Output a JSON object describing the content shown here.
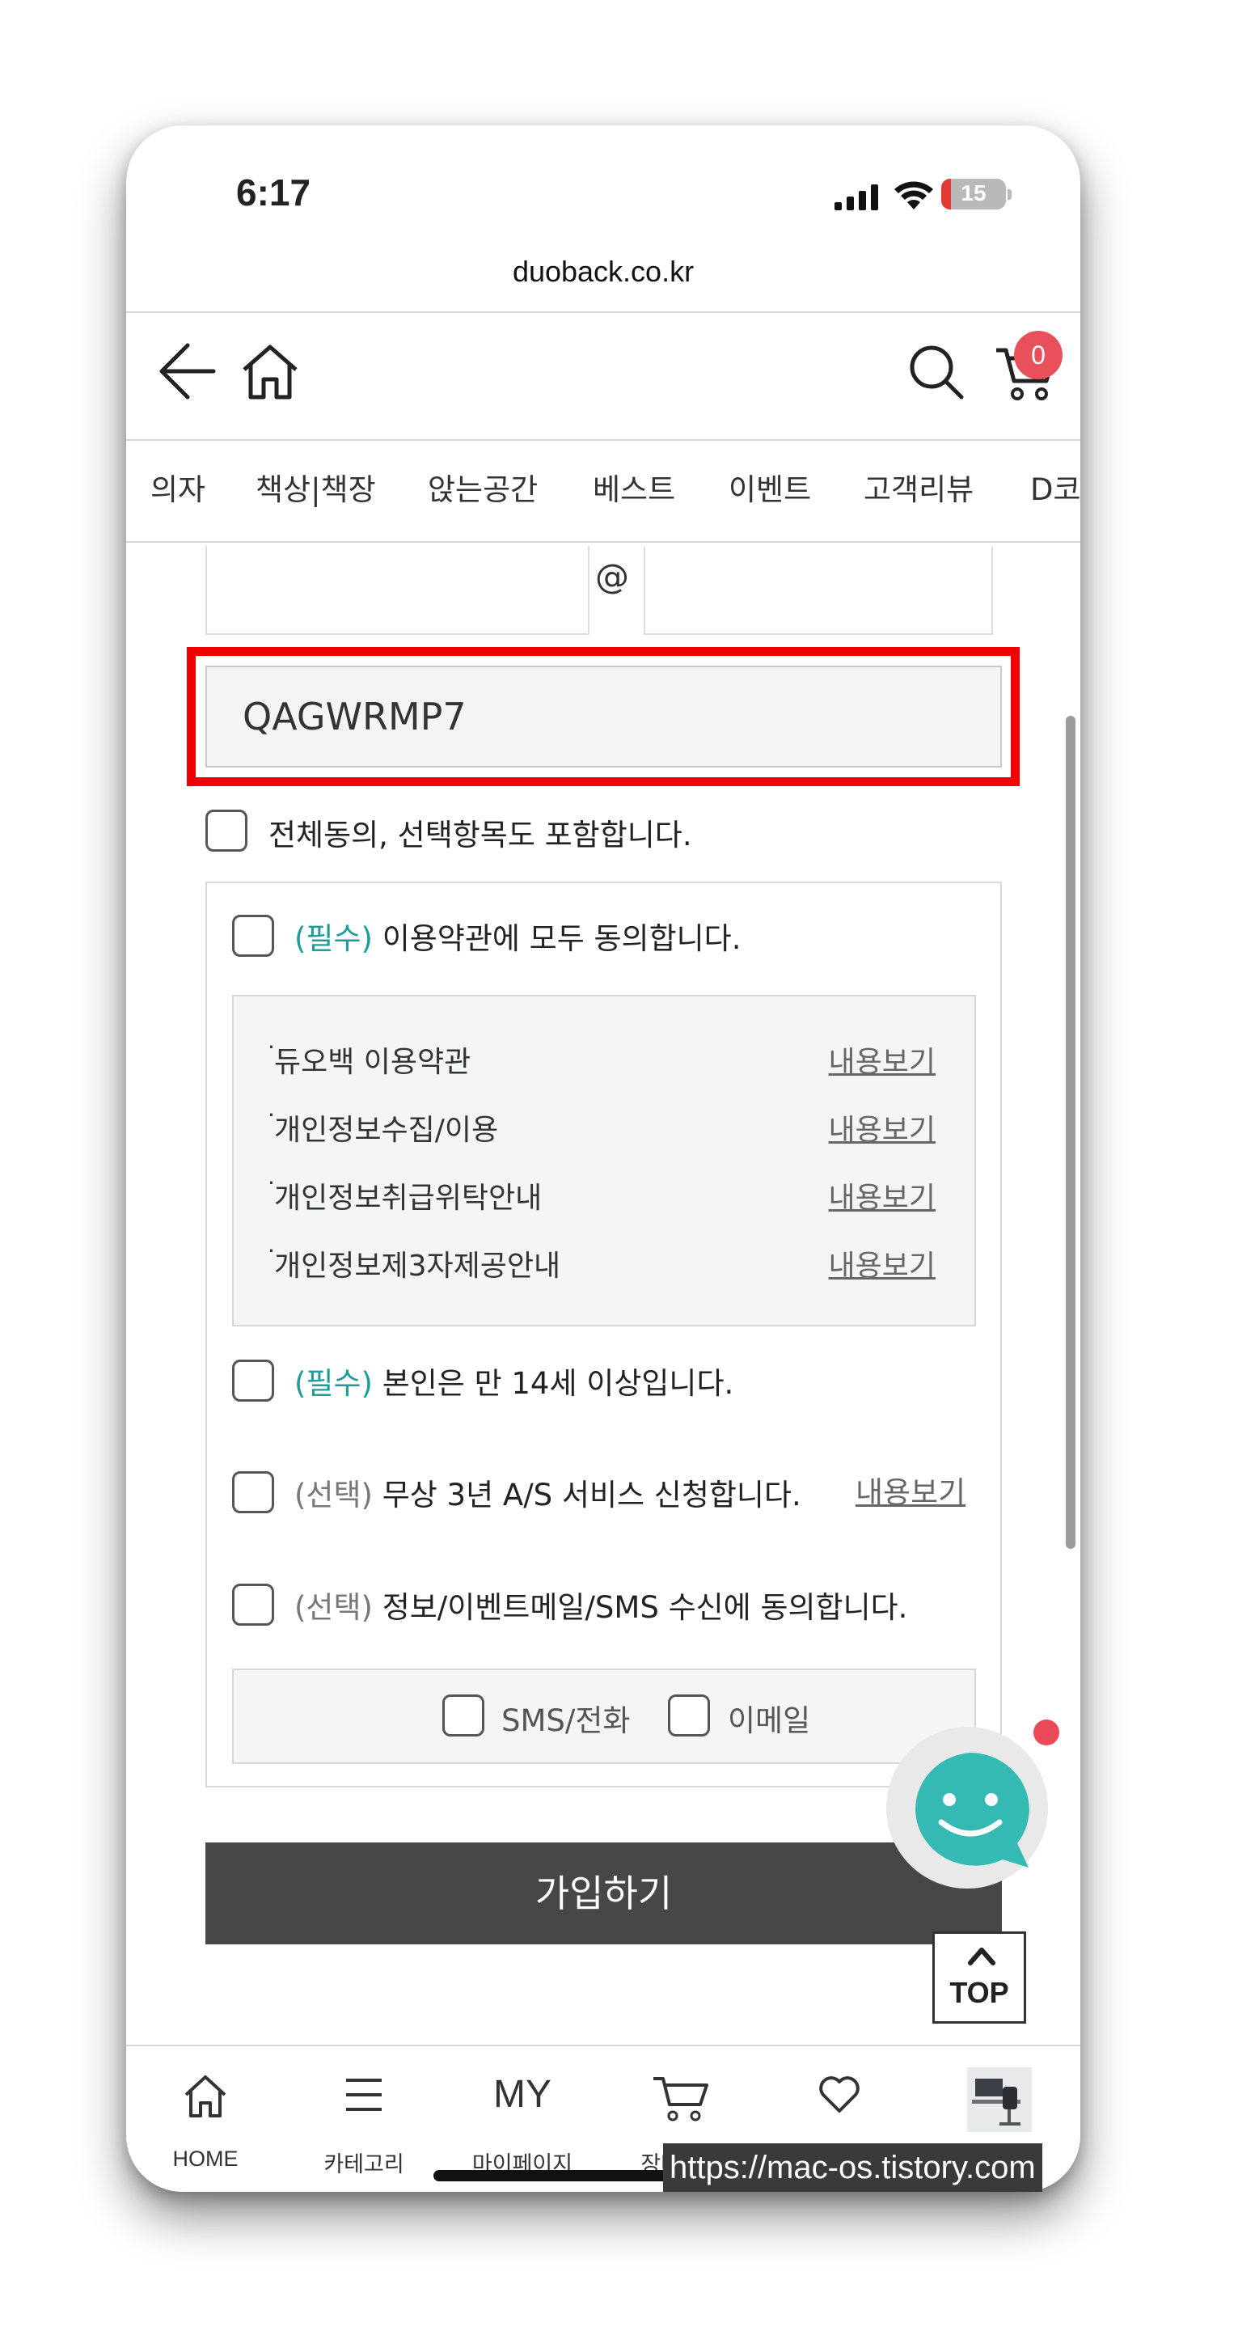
{
  "status_bar": {
    "time": "6:17",
    "battery_level": "15"
  },
  "browser": {
    "url": "duoback.co.kr"
  },
  "header": {
    "cart_count": "0"
  },
  "nav": {
    "items": [
      "의자",
      "책상|책장",
      "앉는공간",
      "베스트",
      "이벤트",
      "고객리뷰",
      "D코"
    ]
  },
  "form": {
    "email_at": "@",
    "code_value": "QAGWRMP7",
    "agree_all": "전체동의, 선택항목도 포함합니다.",
    "terms_all": {
      "tag": "(필수)",
      "label": " 이용약관에 모두 동의합니다."
    },
    "terms": [
      {
        "label": "듀오백 이용약관",
        "link": "내용보기"
      },
      {
        "label": "개인정보수집/이용",
        "link": "내용보기"
      },
      {
        "label": "개인정보취급위탁안내",
        "link": "내용보기"
      },
      {
        "label": "개인정보제3자제공안내",
        "link": "내용보기"
      }
    ],
    "age": {
      "tag": "(필수)",
      "label": " 본인은 만 14세 이상입니다."
    },
    "as_service": {
      "tag": "(선택)",
      "label": " 무상 3년 A/S 서비스 신청합니다.",
      "link": "내용보기"
    },
    "marketing": {
      "tag": "(선택)",
      "label": " 정보/이벤트메일/SMS 수신에 동의합니다."
    },
    "channels": [
      "SMS/전화",
      "이메일"
    ],
    "submit_label": "가입하기"
  },
  "top_button": {
    "label": "TOP"
  },
  "bottom_tabs": [
    "HOME",
    "카테고리",
    "마이페이지",
    "장바구니",
    "",
    ""
  ],
  "bottom_my_glyph": "MY",
  "watermark": "https://mac-os.tistory.com",
  "colors": {
    "required": "#1a9e9a",
    "highlight": "#f00000",
    "badge": "#e8505b",
    "button": "#474747"
  }
}
